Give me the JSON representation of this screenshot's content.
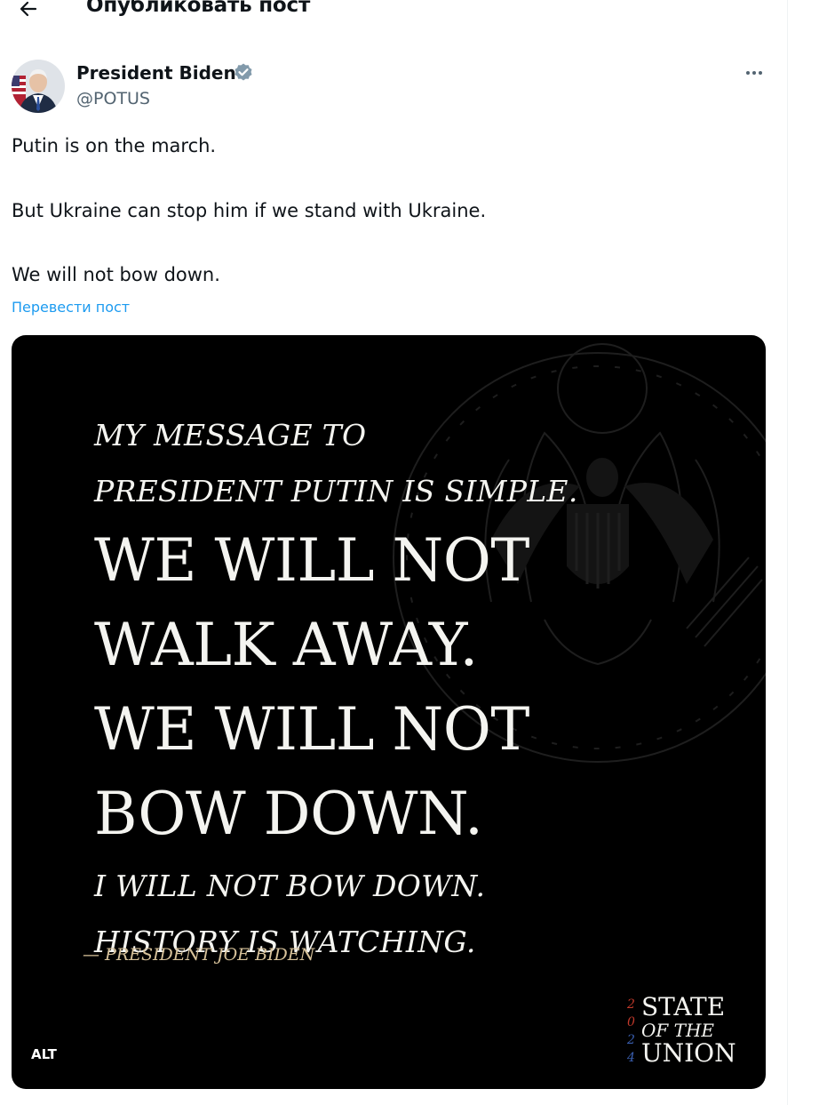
{
  "header": {
    "back_icon": "arrow-left-icon",
    "title": "Опубликовать пост"
  },
  "author": {
    "display_name": "President Biden",
    "verified_icon": "verified-badge-icon",
    "handle": "@POTUS",
    "more_icon": "more-horizontal-icon"
  },
  "tweet": {
    "lines": [
      "Putin is on the march.",
      "But Ukraine can stop him if we stand with Ukraine.",
      "We will not bow down."
    ],
    "translate_label": "Перевести пост"
  },
  "media": {
    "quote_intro": [
      "MY MESSAGE TO",
      "PRESIDENT PUTIN IS SIMPLE."
    ],
    "quote_main": [
      "WE WILL NOT",
      "WALK AWAY.",
      "WE WILL NOT",
      "BOW DOWN."
    ],
    "quote_outro": [
      "I WILL NOT BOW DOWN.",
      "HISTORY IS WATCHING."
    ],
    "attribution": "— PRESIDENT JOE BIDEN",
    "logo": {
      "year_digits": [
        "2",
        "0",
        "2",
        "4"
      ],
      "lines": [
        "STATE",
        "OF THE",
        "UNION"
      ]
    },
    "alt_label": "ALT"
  },
  "colors": {
    "accent_link": "#1d9bf0",
    "secondary_text": "#536471",
    "verified_badge": "#829aab",
    "year_red": "#c0392b",
    "year_blue": "#3a5fb0"
  }
}
